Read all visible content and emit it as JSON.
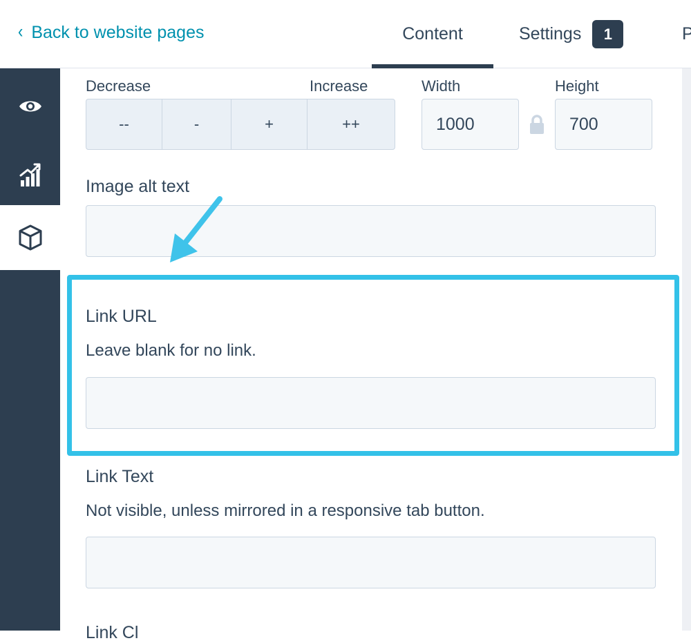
{
  "header": {
    "back_link": "Back to website pages",
    "tabs": [
      {
        "label": "Content",
        "active": true
      },
      {
        "label": "Settings",
        "badge": "1"
      },
      {
        "label": "P"
      }
    ]
  },
  "sidebar": {
    "items": [
      {
        "name": "preview",
        "icon": "eye-icon"
      },
      {
        "name": "optimize",
        "icon": "chart-icon"
      },
      {
        "name": "modules",
        "icon": "cube-icon",
        "active": true
      }
    ]
  },
  "image_size": {
    "decrease_label": "Decrease",
    "increase_label": "Increase",
    "buttons": [
      "--",
      "-",
      "+",
      "++"
    ],
    "width_label": "Width",
    "width_value": "1000",
    "height_label": "Height",
    "height_value": "700"
  },
  "alt_text": {
    "label": "Image alt text",
    "value": ""
  },
  "link_url": {
    "label": "Link URL",
    "help": "Leave blank for no link.",
    "value": ""
  },
  "link_text": {
    "label": "Link Text",
    "help": "Not visible, unless mirrored in a responsive tab button.",
    "value": ""
  },
  "next_field_label_partial": "Link Cl",
  "colors": {
    "accent": "#0091ae",
    "rail": "#2d3e50",
    "highlight": "#33c1e8",
    "input_bg": "#f5f8fa",
    "input_border": "#cbd6e2"
  }
}
